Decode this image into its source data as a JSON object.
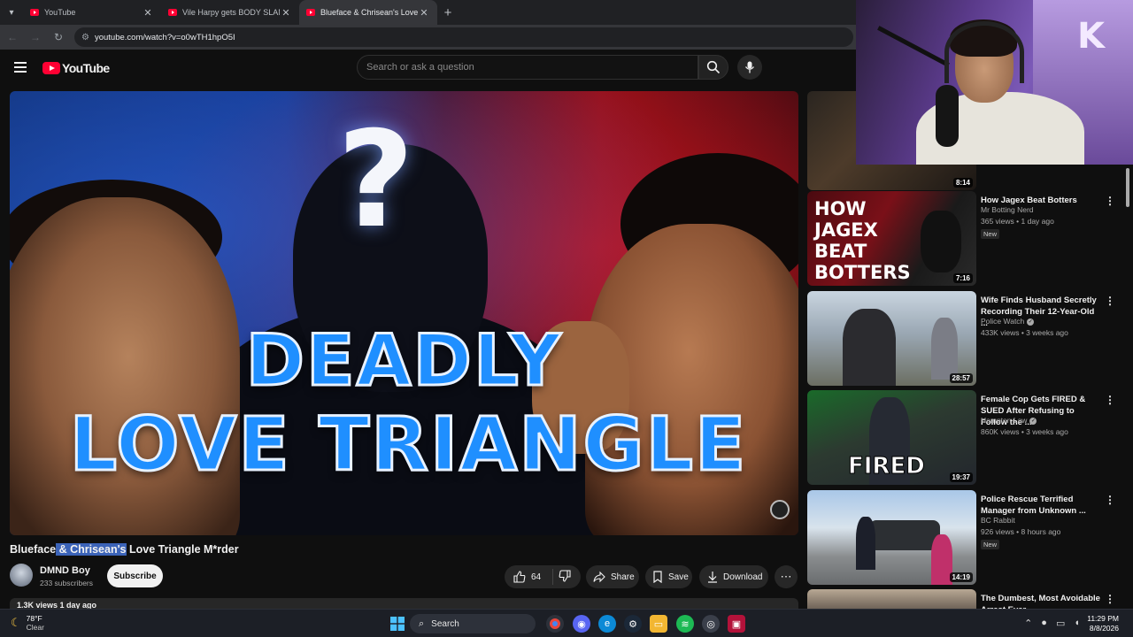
{
  "browser": {
    "tabs": [
      {
        "title": "YouTube",
        "active": false
      },
      {
        "title": "Vile Harpy gets BODY SLAMMED",
        "active": false
      },
      {
        "title": "Blueface & Chrisean's Love Triangle",
        "active": true
      }
    ],
    "url": "youtube.com/watch?v=o0wTH1hpO5I"
  },
  "header": {
    "logo_text": "YouTube",
    "search_placeholder": "Search or ask a question"
  },
  "video": {
    "thumbnail_line1": "DEADLY",
    "thumbnail_line2": "LOVE TRIANGLE",
    "thumbnail_question": "?",
    "title_before": "Blueface",
    "title_highlight": " & Chrisean's",
    "title_after": " Love Triangle M*rder",
    "views_line": "1.3K views  1 day ago"
  },
  "channel": {
    "name": "DMND Boy",
    "subscribers": "233 subscribers",
    "subscribe_label": "Subscribe"
  },
  "actions": {
    "like_count": "64",
    "share_label": "Share",
    "save_label": "Save",
    "download_label": "Download"
  },
  "recommendations": {
    "first_duration": "8:14",
    "items": [
      {
        "title": "How Jagex Beat Botters",
        "channel": "Mr Botting Nerd",
        "verified": false,
        "meta": "365 views • 1 day ago",
        "badge": "New",
        "duration": "7:16",
        "thumb_text": "HOW JAGEX BEAT BOTTERS"
      },
      {
        "title": "Wife Finds Husband Secretly Recording Their 12-Year-Old ...",
        "channel": "Police Watch",
        "verified": true,
        "meta": "433K views • 3 weeks ago",
        "badge": "",
        "duration": "28:57",
        "thumb_text": ""
      },
      {
        "title": "Female Cop Gets FIRED & SUED After Refusing to Follow the ...",
        "channel": "Hampton Law",
        "verified": true,
        "meta": "860K views • 3 weeks ago",
        "badge": "",
        "duration": "19:37",
        "thumb_text": "FIRED"
      },
      {
        "title": "Police Rescue Terrified Manager from Unknown ...",
        "channel": "BC Rabbit",
        "verified": false,
        "meta": "926 views • 8 hours ago",
        "badge": "New",
        "duration": "14:19",
        "thumb_text": ""
      },
      {
        "title": "The Dumbest, Most Avoidable Arrest Ever",
        "channel": "",
        "verified": false,
        "meta": "",
        "badge": "",
        "duration": "",
        "thumb_text": ""
      }
    ]
  },
  "webcam": {
    "wall_letter": "K"
  },
  "taskbar": {
    "temperature": "78°F",
    "weather": "Clear",
    "search_label": "Search",
    "time": "11:29 PM",
    "date": "8/8/2026"
  },
  "colors": {
    "yt_red": "#ff0033",
    "background": "#0f0f0f",
    "highlight": "#3b63b8",
    "thumbnail_text": "#1f8fff"
  }
}
